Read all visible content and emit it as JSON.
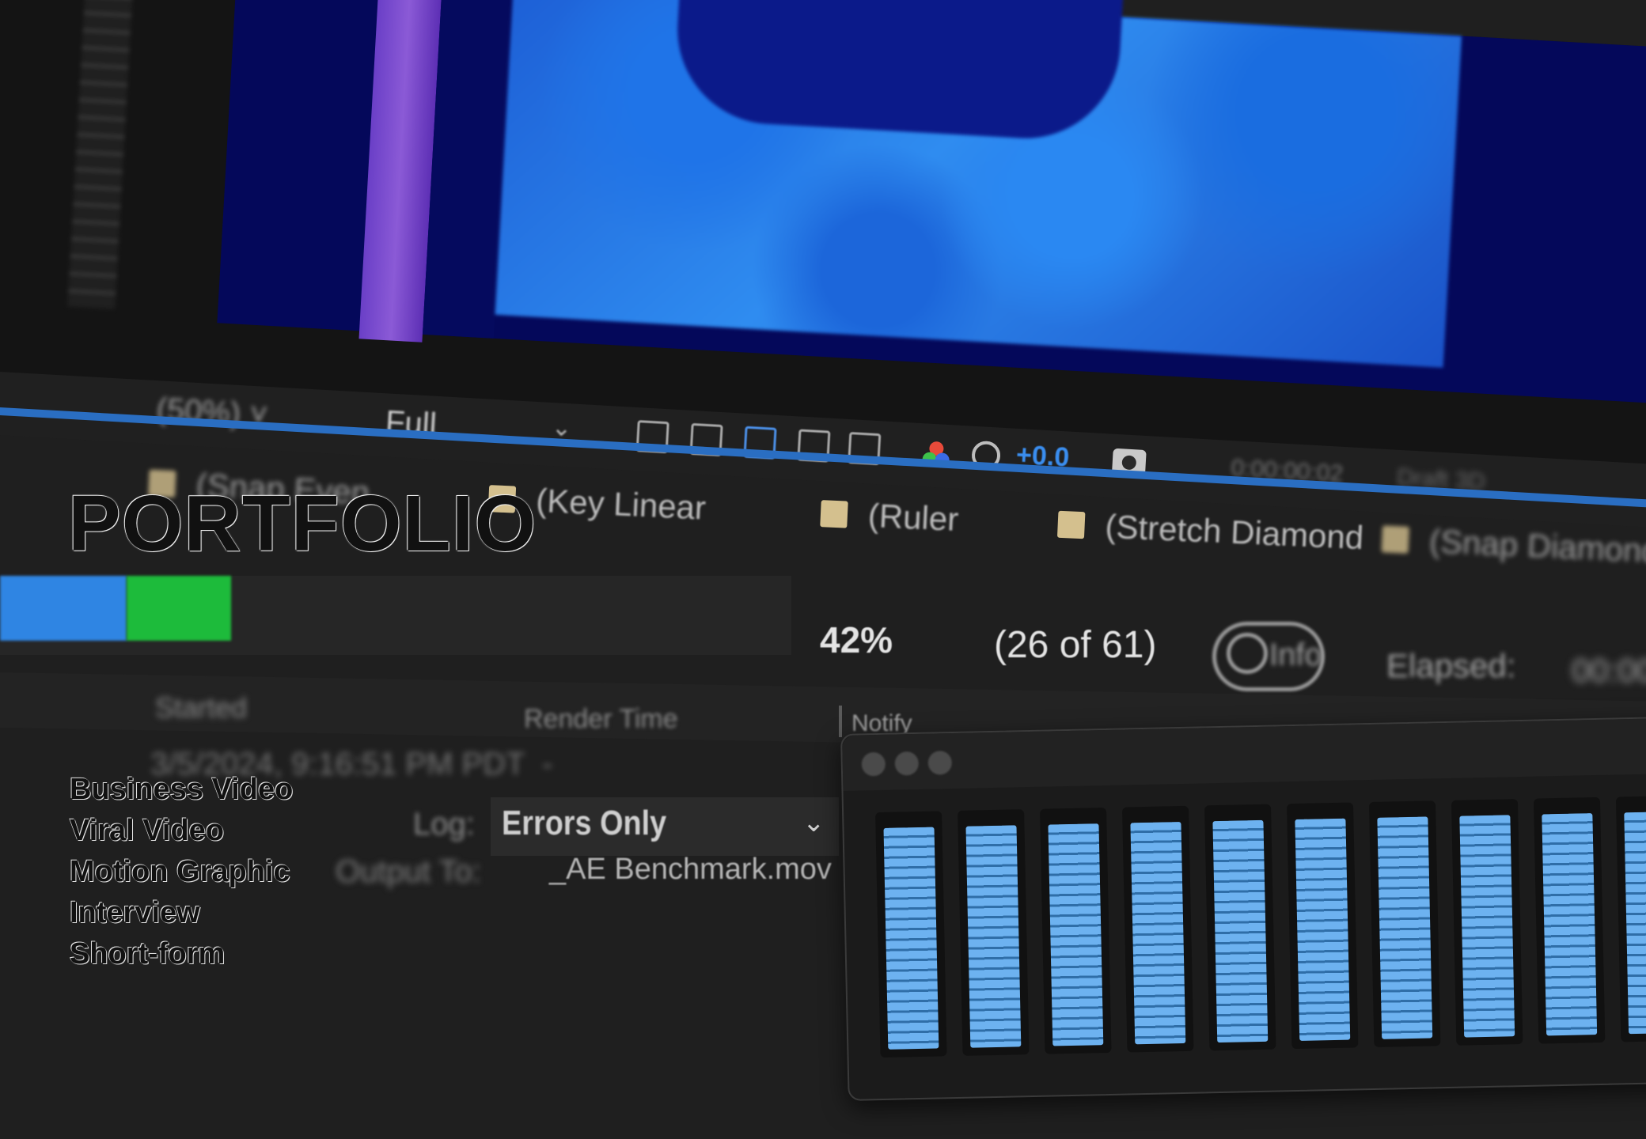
{
  "title": "PORTFOLIO",
  "nav": [
    "Business Video",
    "Viral Video",
    "Motion Graphic",
    "Interview",
    "Short-form"
  ],
  "editor": {
    "resolution_dropdown": "Full",
    "exposure": "+0.0",
    "snap_labels": [
      "(Key Linear",
      "(Ruler",
      "(Stretch Diamond"
    ],
    "render_progress": "42%",
    "render_progress_value": 0.42,
    "frame_count": "(26 of 61)",
    "column_notify": "Notify",
    "log_value": "Errors Only",
    "output_file": "_AE Benchmark.mov"
  },
  "colors": {
    "accent_blue": "#2f85e3",
    "progress_green": "#1dbb3b",
    "meter_blue": "#6db2f0"
  },
  "icons": [
    "brightness-icon",
    "transparency-grid-icon",
    "region-of-interest-icon",
    "safe-margins-icon",
    "grid-icon",
    "rgb-channels-icon",
    "aperture-icon",
    "camera-icon",
    "info-icon"
  ]
}
